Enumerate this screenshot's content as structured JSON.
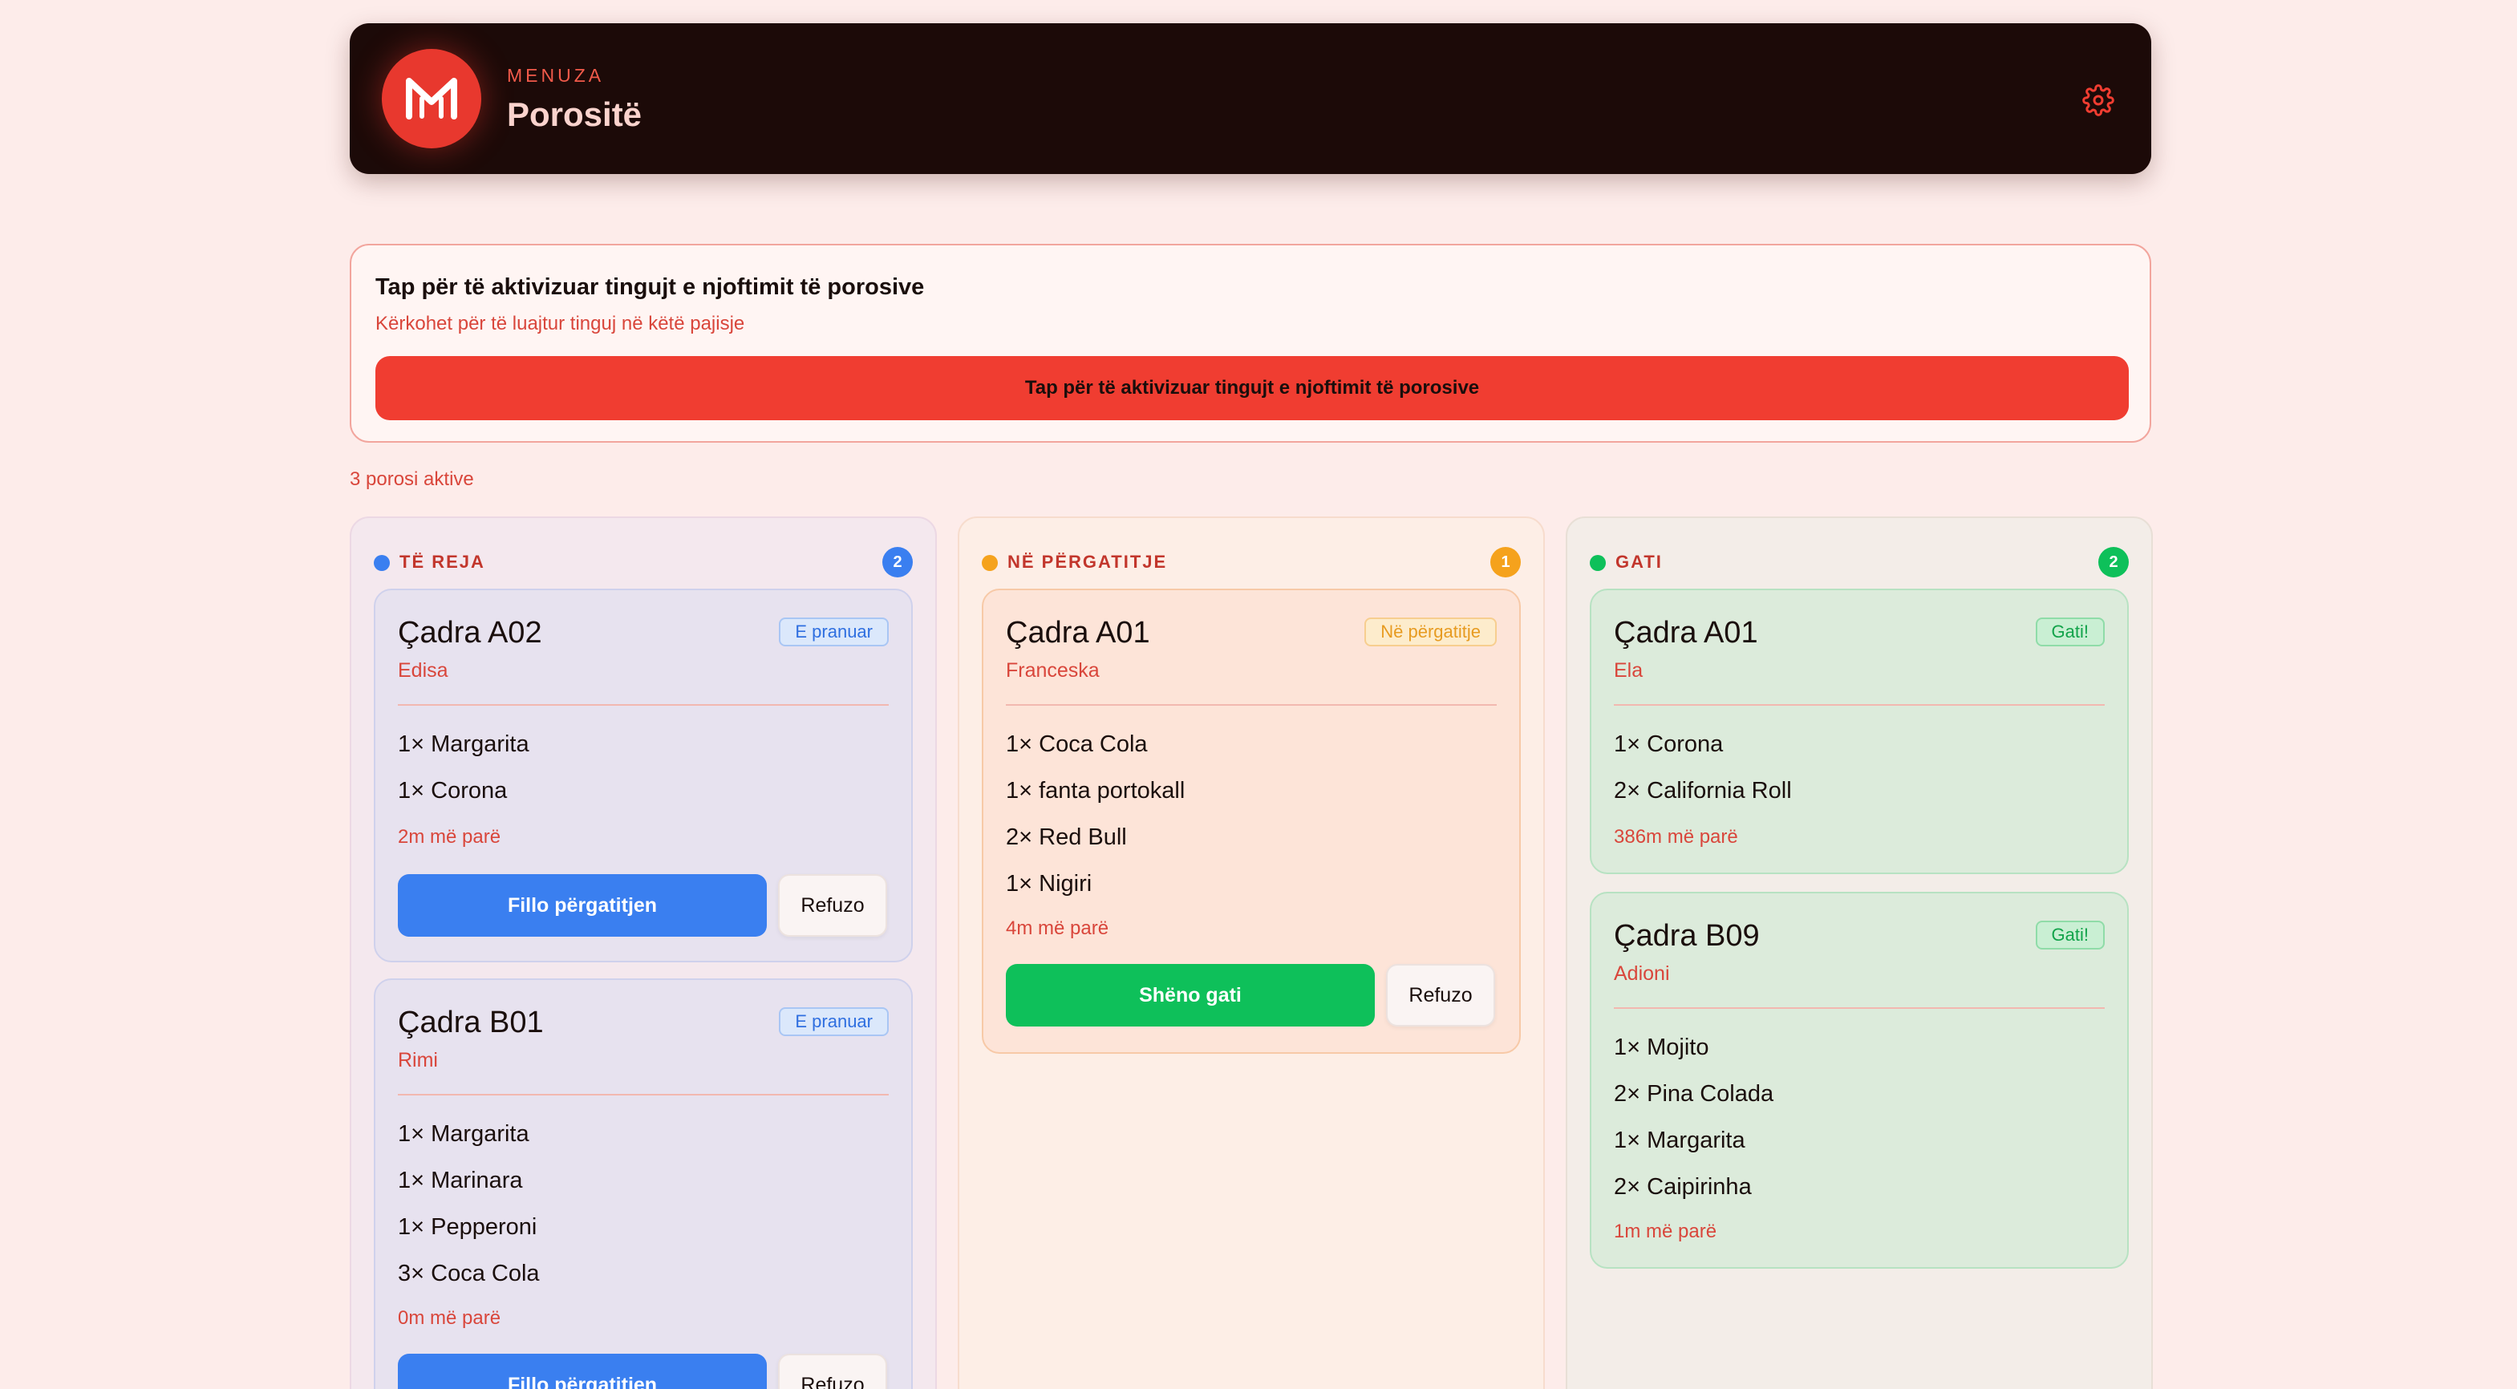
{
  "header": {
    "brand": "MENUZA",
    "title": "Porositë",
    "logo_letter": "M"
  },
  "notice": {
    "title": "Tap për të aktivizuar tingujt e njoftimit të porosive",
    "subtitle": "Kërkohet për të luajtur tinguj në këtë pajisje",
    "button": "Tap për të aktivizuar tingujt e njoftimit të porosive"
  },
  "active_count": "3 porosi aktive",
  "colors": {
    "blue": "#3a7ff0",
    "orange": "#f5a21c",
    "green": "#0ec05a",
    "red": "#f03d31"
  },
  "columns": [
    {
      "title": "TË REJA",
      "count": "2",
      "orders": [
        {
          "table": "Çadra A02",
          "name": "Edisa",
          "status": "E pranuar",
          "items": [
            "1× Margarita",
            "1× Corona"
          ],
          "ago": "2m më parë",
          "primary": "Fillo përgatitjen",
          "refuse": "Refuzo"
        },
        {
          "table": "Çadra B01",
          "name": "Rimi",
          "status": "E pranuar",
          "items": [
            "1× Margarita",
            "1× Marinara",
            "1× Pepperoni",
            "3× Coca Cola"
          ],
          "ago": "0m më parë",
          "primary": "Fillo përgatitjen",
          "refuse": "Refuzo"
        }
      ]
    },
    {
      "title": "NË PËRGATITJE",
      "count": "1",
      "orders": [
        {
          "table": "Çadra A01",
          "name": "Franceska",
          "status": "Në përgatitje",
          "items": [
            "1× Coca Cola",
            "1× fanta portokall",
            "2× Red Bull",
            "1× Nigiri"
          ],
          "ago": "4m më parë",
          "primary": "Shëno gati",
          "refuse": "Refuzo"
        }
      ]
    },
    {
      "title": "GATI",
      "count": "2",
      "orders": [
        {
          "table": "Çadra A01",
          "name": "Ela",
          "status": "Gati!",
          "items": [
            "1× Corona",
            "2× California Roll"
          ],
          "ago": "386m më parë"
        },
        {
          "table": "Çadra B09",
          "name": "Adioni",
          "status": "Gati!",
          "items": [
            "1× Mojito",
            "2× Pina Colada",
            "1× Margarita",
            "2× Caipirinha"
          ],
          "ago": "1m më parë"
        }
      ]
    }
  ]
}
